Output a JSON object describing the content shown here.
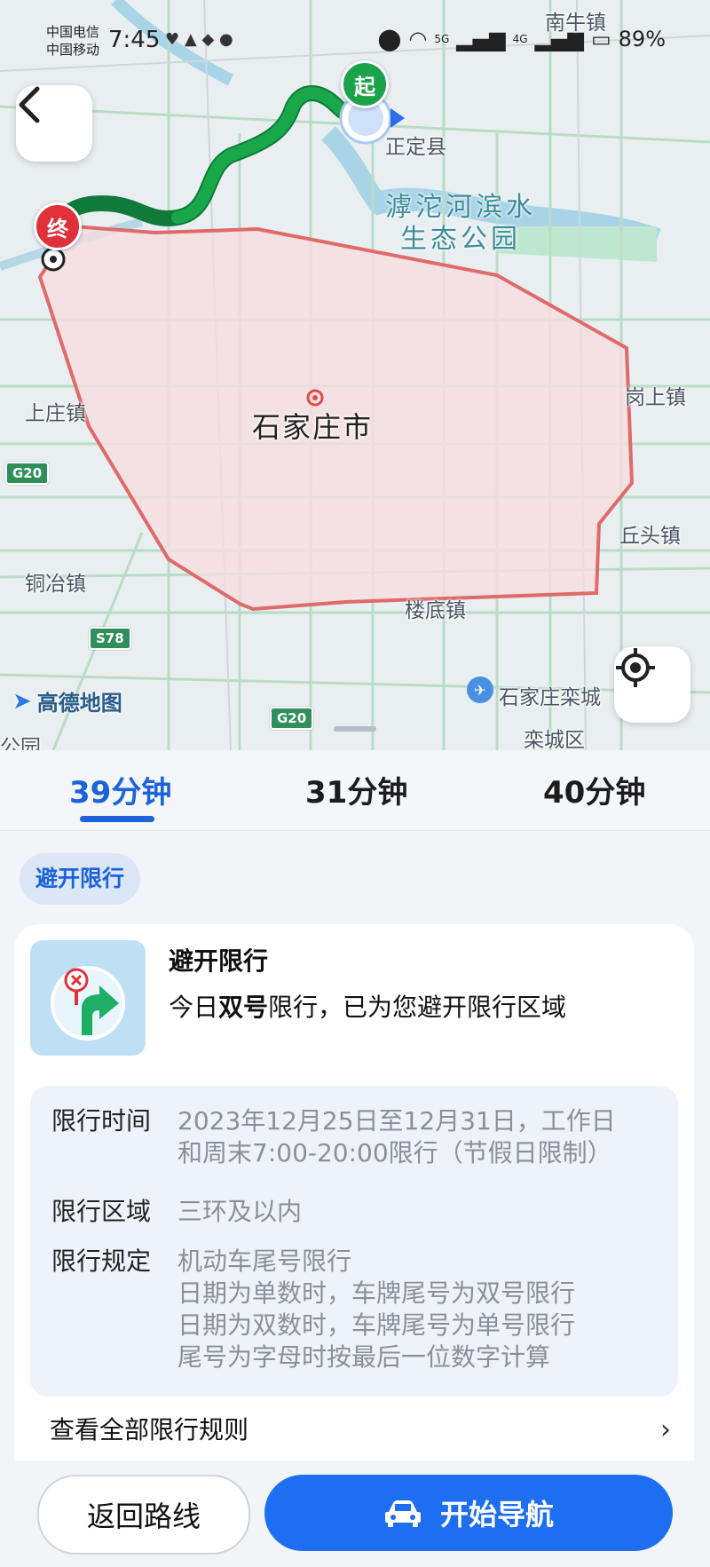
{
  "status_bar": {
    "carrier_1": "中国电信",
    "carrier_2": "中国移动",
    "time": "7:45",
    "network_1": "5G",
    "network_2": "4G",
    "battery": "89%"
  },
  "map": {
    "places": {
      "nanniu": "南牛镇",
      "zhengding": "正定县",
      "park_line1": "滹沱河滨水",
      "park_line2": "生态公园",
      "city": "石家庄市",
      "shangzhuang": "上庄镇",
      "gangshang": "岗上镇",
      "qiutou": "丘头镇",
      "tongye": "铜冶镇",
      "loudi": "楼底镇",
      "airport": "石家庄栾城",
      "luancheng": "栾城区",
      "bottom_left": "公园"
    },
    "highways": {
      "g20_left": "G20",
      "s78": "S78",
      "g20_bottom": "G20"
    },
    "start_pin": "起",
    "end_pin": "终",
    "logo": "高德地图",
    "colors": {
      "restricted_fill": "#f6dde0",
      "restricted_border": "#e06a6a",
      "route": "#18a84a",
      "route_dark": "#0f7a3a"
    }
  },
  "routes": {
    "tabs": [
      {
        "label": "39分钟"
      },
      {
        "label": "31分钟"
      },
      {
        "label": "40分钟"
      }
    ],
    "active_index": 0
  },
  "chip": {
    "label": "避开限行"
  },
  "card": {
    "title": "避开限行",
    "desc_prefix": "今日",
    "desc_bold": "双号",
    "desc_suffix": "限行，已为您避开限行区域",
    "rows": [
      {
        "key": "限行时间",
        "value": "2023年12月25日至12月31日，工作日\n和周末7:00-20:00限行（节假日限制）"
      },
      {
        "key": "限行区域",
        "value": "三环及以内"
      },
      {
        "key": "限行规定",
        "value": "机动车尾号限行\n日期为单数时，车牌尾号为双号限行\n日期为双数时，车牌尾号为单号限行\n尾号为字母时按最后一位数字计算"
      }
    ],
    "all_rules": "查看全部限行规则"
  },
  "buttons": {
    "return": "返回路线",
    "start": "开始导航"
  }
}
